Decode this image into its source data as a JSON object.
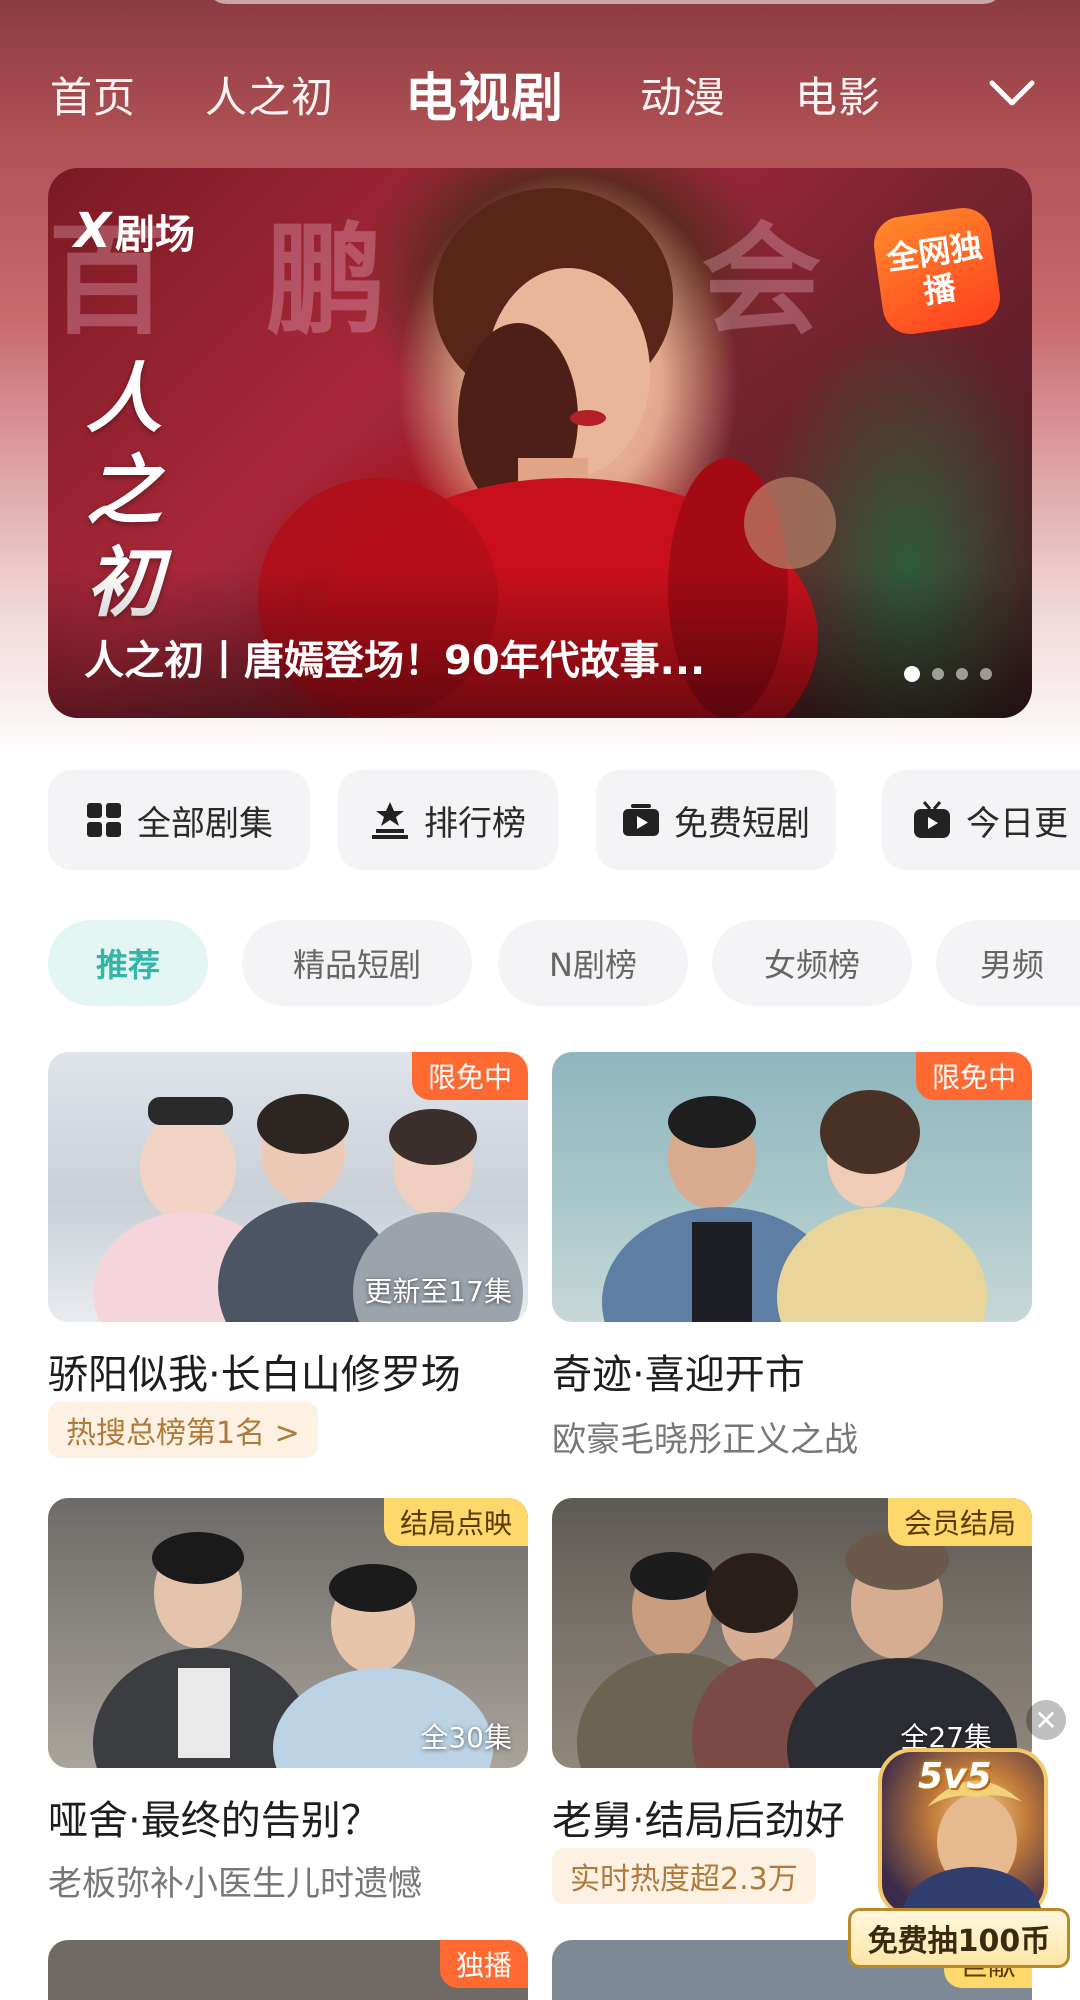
{
  "nav": {
    "tabs": [
      "首页",
      "人之初",
      "电视剧",
      "动漫",
      "电影"
    ],
    "active_tab": "电视剧",
    "more_icon": "chevron-down-icon"
  },
  "banner": {
    "brand": "剧场",
    "brand_mark": "X",
    "background_text": "百 鹏 宴 会",
    "vertical_title": "人之初",
    "badge": "全网独播",
    "caption": "人之初丨唐嫣登场！90年代故事...",
    "slides_total": 4,
    "slide_active": 1
  },
  "quick_entries": [
    {
      "label": "全部剧集",
      "icon": "grid-icon"
    },
    {
      "label": "排行榜",
      "icon": "ranking-icon"
    },
    {
      "label": "免费短剧",
      "icon": "tv-play-icon"
    },
    {
      "label": "今日更",
      "icon": "tv-icon"
    }
  ],
  "categories": [
    "推荐",
    "精品短剧",
    "N剧榜",
    "女频榜",
    "男频"
  ],
  "active_category": "推荐",
  "cards": [
    {
      "title": "骄阳似我·长白山修罗场",
      "tag": "限免中",
      "tag_style": "orange",
      "episodes": "更新至17集",
      "chip": "热搜总榜第1名 >",
      "subtitle": ""
    },
    {
      "title": "奇迹·喜迎开市",
      "tag": "限免中",
      "tag_style": "orange",
      "episodes": "",
      "chip": "",
      "subtitle": "欧豪毛晓彤正义之战"
    },
    {
      "title": "哑舍·最终的告别？",
      "tag": "结局点映",
      "tag_style": "yellow",
      "episodes": "全30集",
      "chip": "",
      "subtitle": "老板弥补小医生儿时遗憾"
    },
    {
      "title": "老舅·结局后劲好",
      "tag": "会员结局",
      "tag_style": "yellow",
      "episodes": "全27集",
      "chip": "实时热度超2.3万",
      "subtitle": ""
    }
  ],
  "next_row_tags": [
    "独播",
    "巨献"
  ],
  "ad": {
    "logo": "5v5",
    "label": "免费抽100币",
    "close": "✕"
  },
  "colors": {
    "accent_teal": "#33b6a7",
    "tag_orange": "#ff6a33",
    "tag_yellow": "#ffd86b",
    "chip_text": "#b07a3a"
  }
}
